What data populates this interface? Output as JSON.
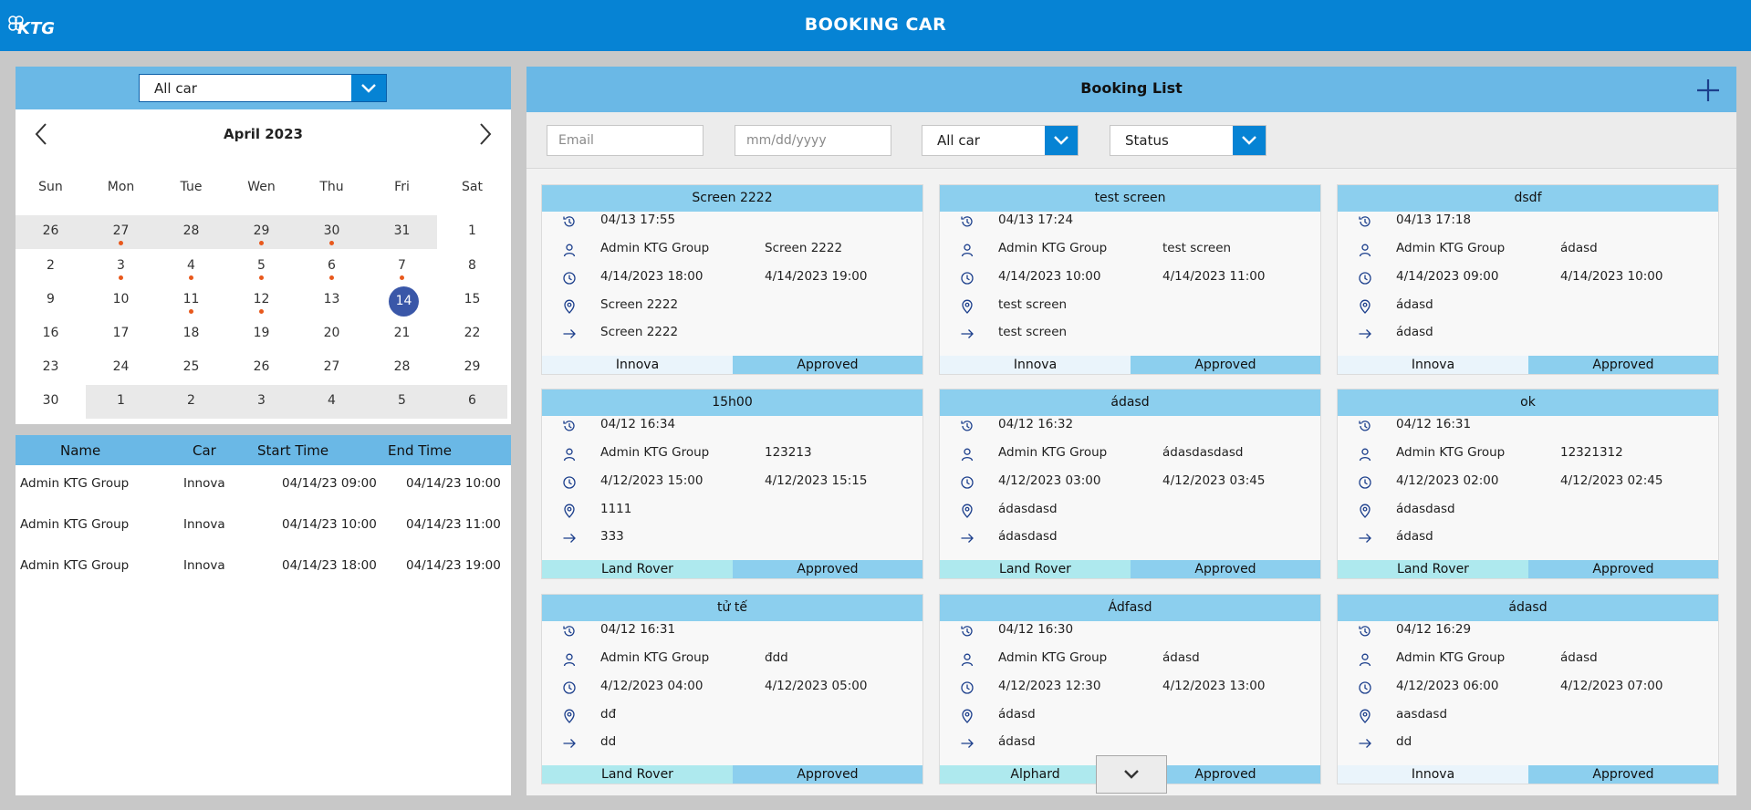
{
  "app": {
    "title": "BOOKING CAR",
    "logo_text": "KTG"
  },
  "calendar": {
    "car_filter": "All car",
    "month_label": "April 2023",
    "weekdays": [
      "Sun",
      "Mon",
      "Tue",
      "Wen",
      "Thu",
      "Fri",
      "Sat"
    ],
    "selected_day": "14",
    "weeks": [
      [
        {
          "d": "26",
          "dim": true
        },
        {
          "d": "27",
          "dim": true,
          "dot": true
        },
        {
          "d": "28",
          "dim": true
        },
        {
          "d": "29",
          "dim": true,
          "dot": true
        },
        {
          "d": "30",
          "dim": true,
          "dot": true
        },
        {
          "d": "31",
          "dim": true
        },
        {
          "d": "1"
        }
      ],
      [
        {
          "d": "2"
        },
        {
          "d": "3",
          "dot": true
        },
        {
          "d": "4",
          "dot": true
        },
        {
          "d": "5",
          "dot": true
        },
        {
          "d": "6",
          "dot": true
        },
        {
          "d": "7",
          "dot": true
        },
        {
          "d": "8"
        }
      ],
      [
        {
          "d": "9"
        },
        {
          "d": "10"
        },
        {
          "d": "11",
          "dot": true
        },
        {
          "d": "12",
          "dot": true
        },
        {
          "d": "13"
        },
        {
          "d": "14",
          "selected": true
        },
        {
          "d": "15"
        }
      ],
      [
        {
          "d": "16"
        },
        {
          "d": "17"
        },
        {
          "d": "18"
        },
        {
          "d": "19"
        },
        {
          "d": "20"
        },
        {
          "d": "21"
        },
        {
          "d": "22"
        }
      ],
      [
        {
          "d": "23"
        },
        {
          "d": "24"
        },
        {
          "d": "25"
        },
        {
          "d": "26"
        },
        {
          "d": "27"
        },
        {
          "d": "28"
        },
        {
          "d": "29"
        }
      ],
      [
        {
          "d": "30"
        },
        {
          "d": "1",
          "dim": true
        },
        {
          "d": "2",
          "dim": true
        },
        {
          "d": "3",
          "dim": true
        },
        {
          "d": "4",
          "dim": true
        },
        {
          "d": "5",
          "dim": true
        },
        {
          "d": "6",
          "dim": true
        }
      ]
    ]
  },
  "day_table": {
    "headers": [
      "Name",
      "Car",
      "Start Time",
      "End Time"
    ],
    "rows": [
      [
        "Admin KTG Group",
        "Innova",
        "04/14/23 09:00",
        "04/14/23 10:00"
      ],
      [
        "Admin KTG Group",
        "Innova",
        "04/14/23 10:00",
        "04/14/23 11:00"
      ],
      [
        "Admin KTG Group",
        "Innova",
        "04/14/23 18:00",
        "04/14/23 19:00"
      ]
    ]
  },
  "booking_list": {
    "title": "Booking List",
    "filters": {
      "email_placeholder": "Email",
      "date_placeholder": "mm/dd/yyyy",
      "car_value": "All car",
      "status_value": "Status"
    },
    "colors": {
      "innova_tag": "#eaf4fb",
      "land_rover_tag": "#aee9ee",
      "alphard_tag": "#aee9ee",
      "status": "#8ccfee"
    },
    "cards": [
      {
        "title": "Screen 2222",
        "created": "04/13 17:55",
        "user": "Admin KTG Group",
        "purpose": "Screen 2222",
        "start": "4/14/2023 18:00",
        "end": "4/14/2023 19:00",
        "from": "Screen 2222",
        "to": "Screen 2222",
        "car": "Innova",
        "car_color": "#eaf4fb",
        "status": "Approved"
      },
      {
        "title": "test screen",
        "created": "04/13 17:24",
        "user": "Admin KTG Group",
        "purpose": "test screen",
        "start": "4/14/2023 10:00",
        "end": "4/14/2023 11:00",
        "from": "test screen",
        "to": "test screen",
        "car": "Innova",
        "car_color": "#eaf4fb",
        "status": "Approved"
      },
      {
        "title": "dsdf",
        "created": "04/13 17:18",
        "user": "Admin KTG Group",
        "purpose": "ádasd",
        "start": "4/14/2023 09:00",
        "end": "4/14/2023 10:00",
        "from": "ádasd",
        "to": "ádasd",
        "car": "Innova",
        "car_color": "#eaf4fb",
        "status": "Approved"
      },
      {
        "title": "15h00",
        "created": "04/12 16:34",
        "user": "Admin KTG Group",
        "purpose": "123213",
        "start": "4/12/2023 15:00",
        "end": "4/12/2023 15:15",
        "from": "1111",
        "to": "333",
        "car": "Land Rover",
        "car_color": "#aee9ee",
        "status": "Approved"
      },
      {
        "title": "ádasd",
        "created": "04/12 16:32",
        "user": "Admin KTG Group",
        "purpose": "ádasdasdasd",
        "start": "4/12/2023 03:00",
        "end": "4/12/2023 03:45",
        "from": "ádasdasd",
        "to": "ádasdasd",
        "car": "Land Rover",
        "car_color": "#aee9ee",
        "status": "Approved"
      },
      {
        "title": "ok",
        "created": "04/12 16:31",
        "user": "Admin KTG Group",
        "purpose": "12321312",
        "start": "4/12/2023 02:00",
        "end": "4/12/2023 02:45",
        "from": "ádasdasd",
        "to": "ádasd",
        "car": "Land Rover",
        "car_color": "#aee9ee",
        "status": "Approved"
      },
      {
        "title": "tử tế",
        "created": "04/12 16:31",
        "user": "Admin KTG Group",
        "purpose": "đdd",
        "start": "4/12/2023 04:00",
        "end": "4/12/2023 05:00",
        "from": "dđ",
        "to": "dd",
        "car": "Land Rover",
        "car_color": "#aee9ee",
        "status": "Approved"
      },
      {
        "title": "Ádfasd",
        "created": "04/12 16:30",
        "user": "Admin KTG Group",
        "purpose": "ádasd",
        "start": "4/12/2023 12:30",
        "end": "4/12/2023 13:00",
        "from": "ádasd",
        "to": "ádasd",
        "car": "Alphard",
        "car_color": "#aee9ee",
        "status": "Approved"
      },
      {
        "title": "ádasd",
        "created": "04/12 16:29",
        "user": "Admin KTG Group",
        "purpose": "ádasd",
        "start": "4/12/2023 06:00",
        "end": "4/12/2023 07:00",
        "from": "aasdasd",
        "to": "dd",
        "car": "Innova",
        "car_color": "#eaf4fb",
        "status": "Approved"
      }
    ]
  }
}
